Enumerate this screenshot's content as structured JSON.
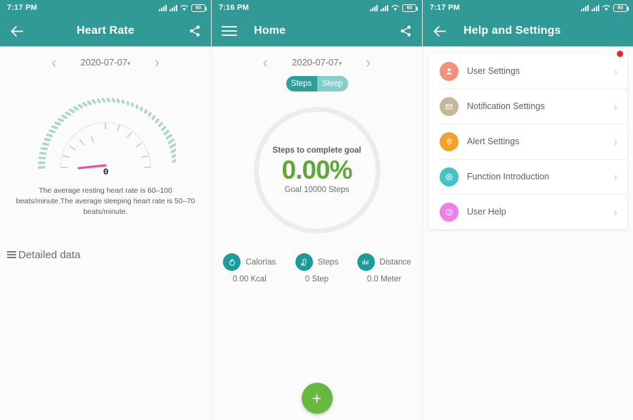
{
  "theme": {
    "teal": "#329a96",
    "teal_dark": "#2f9e9b",
    "teal_light": "#84cdcb",
    "green": "#66b83e",
    "green_text": "#5fa83a",
    "pink_needle": "#ef4fa0",
    "red_badge": "#e8251f",
    "tick_teal": "#a8d4d2"
  },
  "heart_rate_screen": {
    "status": {
      "time": "7:17 PM",
      "battery": "93",
      "signal_icon": "signal-bars-icon",
      "wifi_icon": "wifi-icon"
    },
    "appbar": {
      "title": "Heart Rate",
      "back_icon": "back-arrow-icon",
      "share_icon": "share-icon"
    },
    "date": {
      "prev_icon": "chevron-left-icon",
      "value": "2020-07-07",
      "caret": "▾",
      "next_icon": "chevron-right-icon"
    },
    "gauge": {
      "value": "0",
      "min": 0,
      "max": 200,
      "needle_angle_deg": -5,
      "tick_count": 44
    },
    "note": "The average resting heart rate is 60–100 beats/minute.The average sleeping heart rate is 50–70 beats/minute.",
    "detailed_data_label": "Detailed data",
    "detailed_data_icon": "list-icon"
  },
  "home_screen": {
    "status": {
      "time": "7:16 PM",
      "battery": "93",
      "signal_icon": "signal-bars-icon",
      "wifi_icon": "wifi-icon"
    },
    "appbar": {
      "title": "Home",
      "menu_icon": "hamburger-menu-icon",
      "share_icon": "share-icon"
    },
    "date": {
      "prev_icon": "chevron-left-icon",
      "value": "2020-07-07",
      "caret": "▾",
      "next_icon": "chevron-right-icon"
    },
    "segmented": {
      "options": [
        "Steps",
        "Sleep"
      ],
      "selected": "Steps"
    },
    "progress": {
      "caption": "Steps to complete goal",
      "percent_label": "0.00%",
      "percent_value": 0,
      "goal_label": "Goal 10000 Steps",
      "goal_value": 10000
    },
    "stats": [
      {
        "icon": "flame-icon",
        "name": "Calorías",
        "value": "0.00 Kcal"
      },
      {
        "icon": "footprint-icon",
        "name": "Steps",
        "value": "0 Step"
      },
      {
        "icon": "bar-chart-icon",
        "name": "Distance",
        "value": "0.0 Meter"
      }
    ],
    "fab": {
      "icon": "plus-icon",
      "label": "+"
    }
  },
  "settings_screen": {
    "status": {
      "time": "7:17 PM",
      "battery": "93",
      "signal_icon": "signal-bars-icon",
      "wifi_icon": "wifi-icon"
    },
    "appbar": {
      "title": "Help and Settings",
      "back_icon": "back-arrow-icon"
    },
    "items": [
      {
        "label": "User Settings",
        "icon": "user-icon",
        "color": "#f0917b",
        "badge": true,
        "chevron": "›"
      },
      {
        "label": "Notification Settings",
        "icon": "envelope-icon",
        "color": "#c7b799",
        "badge": false,
        "chevron": "›"
      },
      {
        "label": "Alert Settings",
        "icon": "bell-location-icon",
        "color": "#f6a02c",
        "badge": false,
        "chevron": "›"
      },
      {
        "label": "Function Introduction",
        "icon": "list-doc-icon",
        "color": "#3fc4c9",
        "badge": false,
        "chevron": "›"
      },
      {
        "label": "User Help",
        "icon": "question-icon",
        "color": "#ef7fe8",
        "badge": false,
        "chevron": "›"
      }
    ]
  }
}
